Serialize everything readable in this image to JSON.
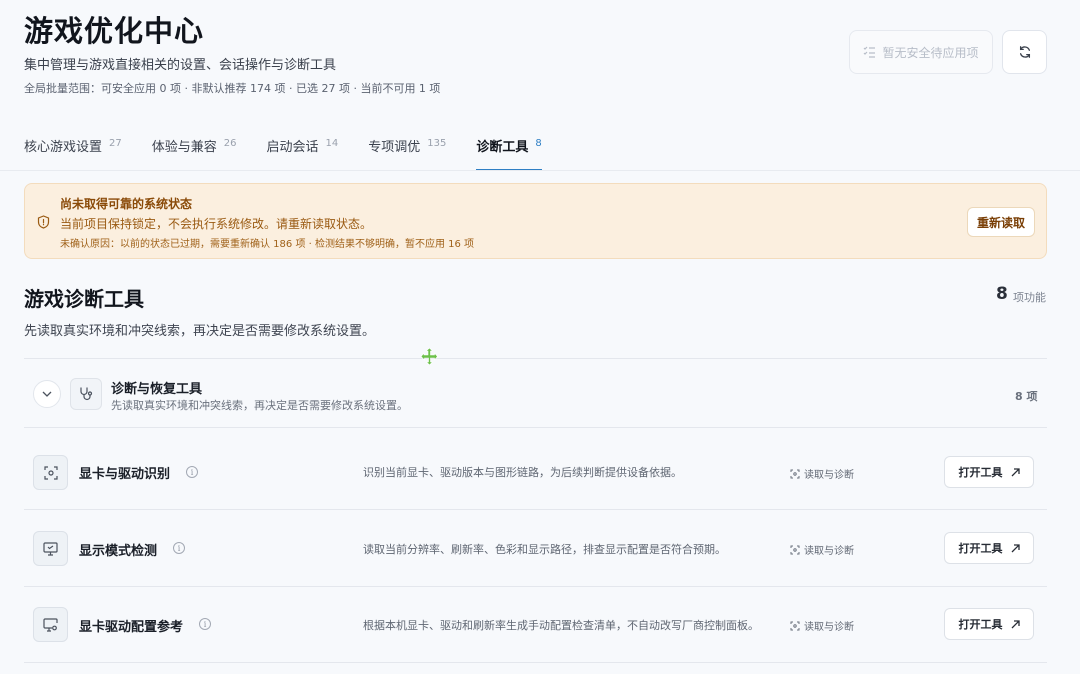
{
  "header": {
    "title": "游戏优化中心",
    "subtitle": "集中管理与游戏直接相关的设置、会话操作与诊断工具",
    "scope": "全局批量范围：可安全应用 0 项 · 非默认推荐 174 项 · 已选 27 项 · 当前不可用 1 项",
    "pending_button": "暂无安全待应用项",
    "refresh_icon": "refresh-icon"
  },
  "tabs": [
    {
      "label": "核心游戏设置",
      "count": "27",
      "active": false
    },
    {
      "label": "体验与兼容",
      "count": "26",
      "active": false
    },
    {
      "label": "启动会话",
      "count": "14",
      "active": false
    },
    {
      "label": "专项调优",
      "count": "135",
      "active": false
    },
    {
      "label": "诊断工具",
      "count": "8",
      "active": true
    }
  ],
  "alert": {
    "title": "尚未取得可靠的系统状态",
    "message": "当前项目保持锁定，不会执行系统修改。请重新读取状态。",
    "reason": "未确认原因：以前的状态已过期，需要重新确认 186 项 · 检测结果不够明确，暂不应用 16 项",
    "button": "重新读取",
    "icon": "shield-alert-icon"
  },
  "section": {
    "title": "游戏诊断工具",
    "description": "先读取真实环境和冲突线索，再决定是否需要修改系统设置。",
    "count": "8",
    "count_label": "项功能"
  },
  "group": {
    "title": "诊断与恢复工具",
    "description": "先读取真实环境和冲突线索，再决定是否需要修改系统设置。",
    "count": "8 项",
    "icon": "stethoscope-icon"
  },
  "rows": [
    {
      "name": "显卡与驱动识别",
      "description": "识别当前显卡、驱动版本与图形链路，为后续判断提供设备依据。",
      "tag": "读取与诊断",
      "button": "打开工具",
      "icon": "scan-icon"
    },
    {
      "name": "显示模式检测",
      "description": "读取当前分辨率、刷新率、色彩和显示路径，排查显示配置是否符合预期。",
      "tag": "读取与诊断",
      "button": "打开工具",
      "icon": "monitor-icon"
    },
    {
      "name": "显卡驱动配置参考",
      "description": "根据本机显卡、驱动和刷新率生成手动配置检查清单，不自动改写厂商控制面板。",
      "tag": "读取与诊断",
      "button": "打开工具",
      "icon": "monitor-settings-icon"
    }
  ],
  "colors": {
    "accent": "#2f7fc4",
    "warning_bg": "#fbefdf",
    "warning_text": "#8a4a08"
  }
}
